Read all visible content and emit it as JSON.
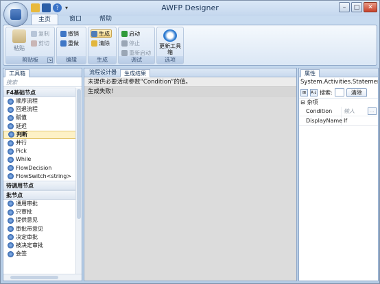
{
  "window": {
    "title": "AWFP Designer",
    "minimize": "–",
    "maximize": "□",
    "close": "✕"
  },
  "qat": {
    "more": "▾"
  },
  "ribbon": {
    "tabs": [
      {
        "label": "主页"
      },
      {
        "label": "窗口"
      },
      {
        "label": "帮助"
      }
    ],
    "groups": {
      "clipboard": {
        "label": "剪贴板",
        "paste": "粘贴",
        "copy": "复制",
        "cut": "剪切",
        "launcher": "↘"
      },
      "edit": {
        "label": "编辑",
        "undo": "撤销",
        "redo": "重做"
      },
      "build": {
        "label": "生成",
        "build": "生成",
        "clean": "清除"
      },
      "debug": {
        "label": "调试",
        "start": "启动",
        "stop": "停止",
        "restart": "重新启动"
      },
      "options": {
        "label": "选项",
        "update_toolbox": "更新工具箱"
      }
    }
  },
  "toolbox": {
    "tab": "工具箱",
    "search_placeholder": "搜索",
    "categories": [
      {
        "name": "F4基础节点",
        "items": [
          "顺序流程",
          "回退流程",
          "赋值",
          "延迟",
          "判断",
          "并行",
          "Pick",
          "While",
          "FlowDecision",
          "FlowSwitch<string>"
        ]
      },
      {
        "name": "待调用节点",
        "items": []
      },
      {
        "name": "批节点",
        "items": [
          "通用审批",
          "只审批",
          "提供意见",
          "审批带意见",
          "决定审批",
          "被决定审批",
          "会签"
        ]
      }
    ],
    "selected_item": "判断"
  },
  "center": {
    "tabs": [
      {
        "label": "流程设计器"
      },
      {
        "label": "生成结果"
      }
    ],
    "messages": [
      "未提供必要活动参数“Condition”的值。",
      "生成失败！"
    ]
  },
  "properties": {
    "tab": "属性",
    "type_name": "System.Activities.Statements.If",
    "search_label": "搜索:",
    "clear_label": "清除",
    "sort_icon_text": "A↓",
    "category_icon_text": "⊞",
    "category": {
      "toggle": "⊟",
      "name": "杂项"
    },
    "rows": [
      {
        "name": "Condition",
        "value": "输入",
        "has_button": true,
        "button_label": "..."
      },
      {
        "name": "DisplayName",
        "value": "If",
        "has_button": false
      }
    ]
  },
  "colors": {
    "chrome": "#b9d1ea",
    "ribbon": "#dbe7f5",
    "selected": "#fdf1c6",
    "center_bg": "#dcdcdc"
  }
}
